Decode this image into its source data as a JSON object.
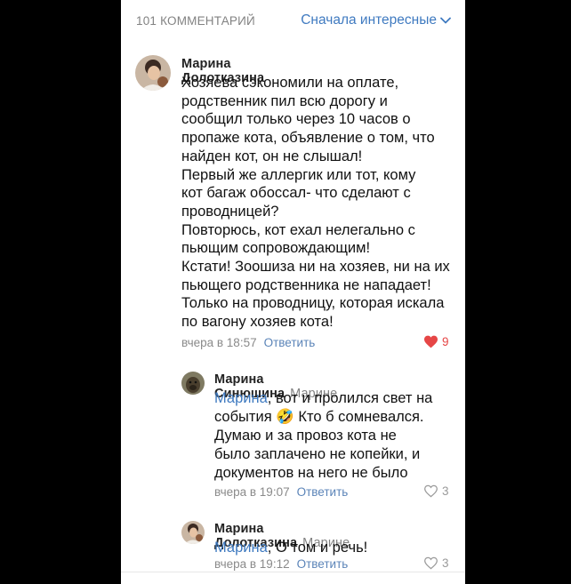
{
  "header": {
    "count": "101 КОММЕНТАРИЙ",
    "sort": "Сначала интересные"
  },
  "comments": [
    {
      "author": "Марина Долотказина",
      "text": "Хозяева сэкономили на оплате,\nродственник пил всю дорогу и\nсообщил только через 10 часов о\nпропаже кота, объявление о том, что\nнайден кот, он не слышал!\nПервый же аллергик или тот, кому\nкот багаж обоссал- что сделают с\nпроводницей?\nПовторюсь, кот ехал нелегально с\nпьющим сопровождающим!\nКстати! Зоошиза ни на хозяев, ни на их\nпьющего родственника не нападает!\nТолько на проводницу, которая искала\nпо вагону хозяев кота!",
      "time": "вчера в 18:57",
      "reply": "Ответить",
      "likes": "9",
      "liked": true
    },
    {
      "author": "Марина Синюшина",
      "reply_to": "Марине",
      "mention": "Марина",
      "text_after_mention": ", вот и пролился свет на\nсобытия 🤣 Кто б сомневался.\nДумаю и за провоз кота не\nбыло заплачено не копейки, и\nдокументов на него не было",
      "time": "вчера в 19:07",
      "reply": "Ответить",
      "likes": "3",
      "liked": false
    },
    {
      "author": "Марина Долотказина",
      "reply_to": "Марине",
      "mention": "Марина",
      "text_after_mention": ", О том и речь!",
      "time": "вчера в 19:12",
      "reply": "Ответить",
      "likes": "3",
      "liked": false
    }
  ],
  "colors": {
    "accent": "#3f7ac0",
    "like_red": "#e64646",
    "meta_gray": "#8a8a8a"
  }
}
